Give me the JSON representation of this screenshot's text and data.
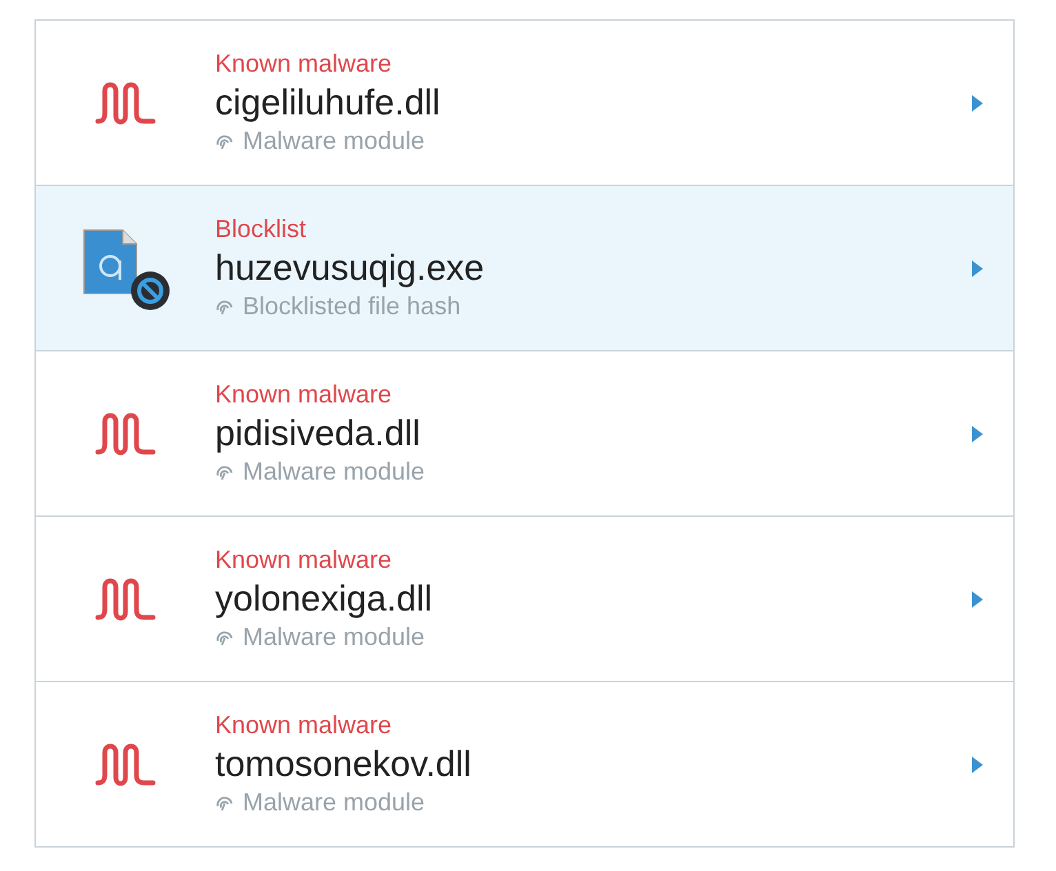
{
  "items": [
    {
      "kind": "malware",
      "category": "Known malware",
      "name": "cigeliluhufe.dll",
      "detail": "Malware module",
      "selected": false
    },
    {
      "kind": "blocklist",
      "category": "Blocklist",
      "name": "huzevusuqig.exe",
      "detail": "Blocklisted file hash",
      "selected": true
    },
    {
      "kind": "malware",
      "category": "Known malware",
      "name": "pidisiveda.dll",
      "detail": "Malware module",
      "selected": false
    },
    {
      "kind": "malware",
      "category": "Known malware",
      "name": "yolonexiga.dll",
      "detail": "Malware module",
      "selected": false
    },
    {
      "kind": "malware",
      "category": "Known malware",
      "name": "tomosonekov.dll",
      "detail": "Malware module",
      "selected": false
    }
  ]
}
